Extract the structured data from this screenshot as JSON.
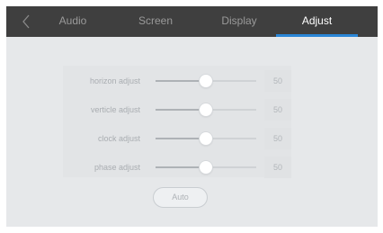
{
  "header": {
    "back_icon": "chevron-left-icon",
    "tabs": [
      {
        "label": "Audio",
        "active": false
      },
      {
        "label": "Screen",
        "active": false
      },
      {
        "label": "Display",
        "active": false
      },
      {
        "label": "Adjust",
        "active": true
      }
    ]
  },
  "adjust": {
    "rows": [
      {
        "label": "horizon adjust",
        "value": "50",
        "level": 50
      },
      {
        "label": "verticle adjust",
        "value": "50",
        "level": 50
      },
      {
        "label": "clock adjust",
        "value": "50",
        "level": 50
      },
      {
        "label": "phase adjust",
        "value": "50",
        "level": 50
      }
    ],
    "auto_label": "Auto"
  },
  "colors": {
    "header_bg": "#3f3f3f",
    "active_underline": "#2a86d6",
    "content_bg": "#e6e8ea"
  }
}
